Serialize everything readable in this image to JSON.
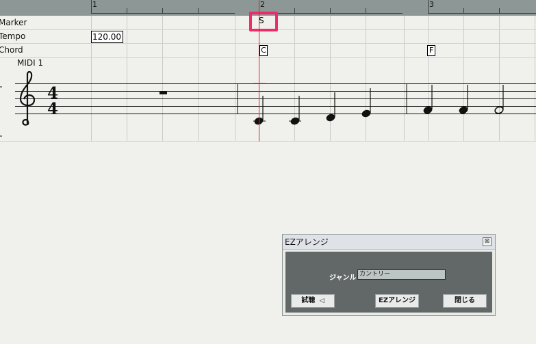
{
  "ruler": {
    "bar_numbers": [
      "1",
      "2",
      "3"
    ]
  },
  "tracks": {
    "marker_label": "Marker",
    "tempo_label": "Tempo",
    "chord_label": "Chord"
  },
  "tempo_value": "120.00",
  "marker_value": "S",
  "chords": [
    "C",
    "F"
  ],
  "midi_track_name": "MIDI 1",
  "time_signature": {
    "top": "4",
    "bottom": "4"
  },
  "colors": {
    "highlight": "#ee2a6b",
    "playhead": "#e02020"
  },
  "dialog": {
    "title": "EZアレンジ",
    "genre_label": "ジャンル",
    "genre_value": "カントリー",
    "buttons": {
      "preview": "試聴",
      "arrange": "EZアレンジ",
      "close": "閉じる"
    },
    "close_icon": "close-icon"
  }
}
